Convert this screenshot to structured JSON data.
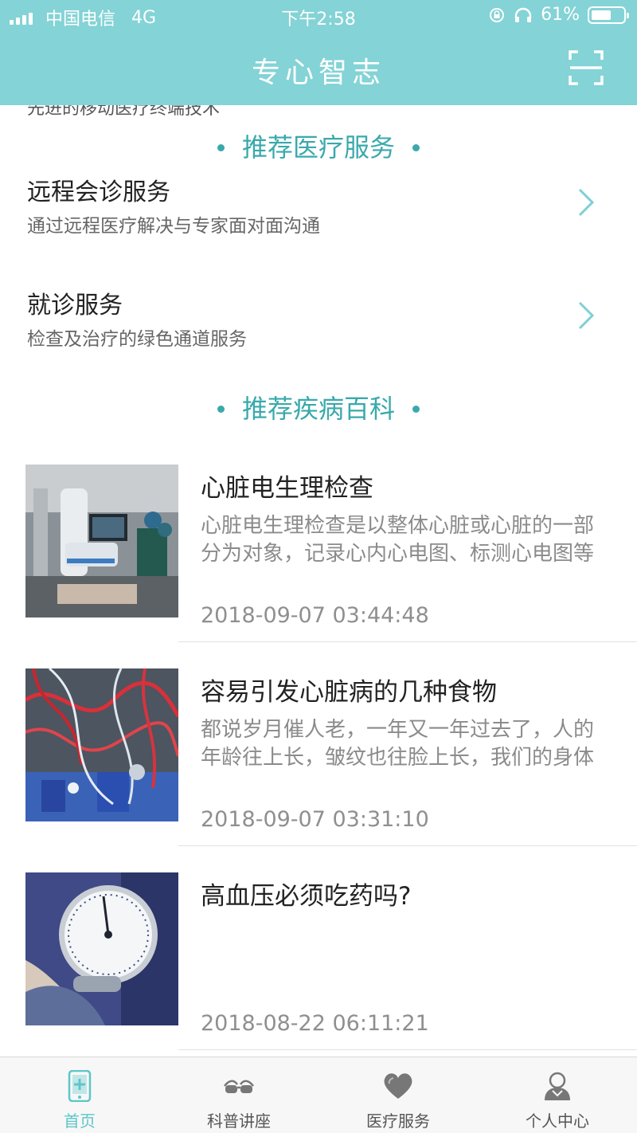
{
  "status_bar": {
    "carrier": "中国电信",
    "network": "4G",
    "time": "下午2:58",
    "battery": "61%"
  },
  "header": {
    "title": "专心智志",
    "scan_icon": "scan-icon",
    "bg_color": "#84d3d6"
  },
  "cut_off_text": "先进的移动医疗终端技术",
  "services_section": {
    "heading": "推荐医疗服务",
    "items": [
      {
        "name": "远程会诊服务",
        "desc": "通过远程医疗解决与专家面对面沟通",
        "icon": "chevron-right-icon"
      },
      {
        "name": "就诊服务",
        "desc": "检查及治疗的绿色通道服务",
        "icon": "chevron-right-icon"
      }
    ]
  },
  "articles_section": {
    "heading": "推荐疾病百科",
    "items": [
      {
        "title": "心脏电生理检查",
        "summary": "心脏电生理检查是以整体心脏或心脏的一部分为对象，记录心内心电图、标测心电图等",
        "date": "2018-09-07 03:44:48",
        "image": "operating-room-photo"
      },
      {
        "title": "容易引发心脏病的几种食物",
        "summary": "都说岁月催人老，一年又一年过去了，人的年龄往上长，皱纹也往脸上长，我们的身体",
        "date": "2018-09-07 03:31:10",
        "image": "medical-tubes-photo"
      },
      {
        "title": "高血压必须吃药吗?",
        "summary": "",
        "date": "2018-08-22 06:11:21",
        "image": "blood-pressure-gauge-photo"
      }
    ]
  },
  "tab_bar": {
    "active_color": "#5dc6c9",
    "tabs": [
      {
        "label": "首页",
        "icon": "home-phone-icon",
        "active": true
      },
      {
        "label": "科普讲座",
        "icon": "glasses-icon",
        "active": false
      },
      {
        "label": "医疗服务",
        "icon": "heart-icon",
        "active": false
      },
      {
        "label": "个人中心",
        "icon": "user-icon",
        "active": false
      }
    ]
  }
}
